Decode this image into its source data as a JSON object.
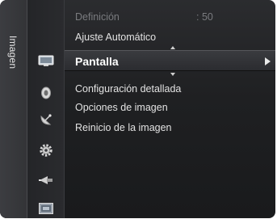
{
  "side_tab": {
    "label": "Imagen"
  },
  "menu": {
    "top_item": {
      "label": "Definición",
      "value": ": 50"
    },
    "items": [
      {
        "label": "Ajuste Automático"
      },
      {
        "label": "Configuración detallada"
      },
      {
        "label": "Opciones de imagen"
      },
      {
        "label": "Reinicio de la imagen"
      }
    ],
    "selected": {
      "label": "Pantalla"
    }
  },
  "icons": [
    "display-icon",
    "sound-icon",
    "channel-icon",
    "setup-icon",
    "input-icon",
    "application-icon"
  ]
}
